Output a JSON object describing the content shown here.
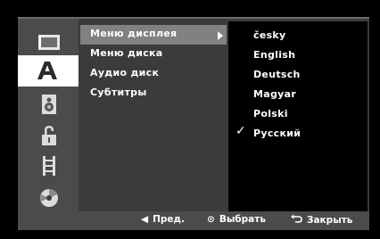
{
  "sidebar": {
    "items": [
      {
        "icon": "display-icon",
        "active": false
      },
      {
        "icon": "language-a-icon",
        "active": true
      },
      {
        "icon": "speaker-icon",
        "active": false
      },
      {
        "icon": "lock-icon",
        "active": false
      },
      {
        "icon": "film-icon",
        "active": false
      },
      {
        "icon": "disc-icon",
        "active": false
      }
    ]
  },
  "submenu": {
    "items": [
      {
        "label": "Меню дисплея",
        "highlighted": true
      },
      {
        "label": "Меню диска",
        "highlighted": false
      },
      {
        "label": "Аудио диск",
        "highlighted": false
      },
      {
        "label": "Субтитры",
        "highlighted": false
      }
    ]
  },
  "languages": {
    "items": [
      {
        "label": "česky"
      },
      {
        "label": "English"
      },
      {
        "label": "Deutsch"
      },
      {
        "label": "Magyar"
      },
      {
        "label": "Polski"
      },
      {
        "label": "Русский"
      }
    ],
    "selected": "Русский",
    "check_symbol": "✓"
  },
  "footer": {
    "prev_icon": "◀",
    "prev_label": "Пред.",
    "select_icon": "⊙",
    "select_label": "Выбрать",
    "close_icon": "return-icon",
    "close_label": "Закрыть"
  },
  "colors": {
    "panel": "#3b3b3b",
    "sidebar": "#4b4b4b",
    "highlight": "#818181",
    "active_tab": "#ffffff",
    "options_bg": "#000000"
  }
}
